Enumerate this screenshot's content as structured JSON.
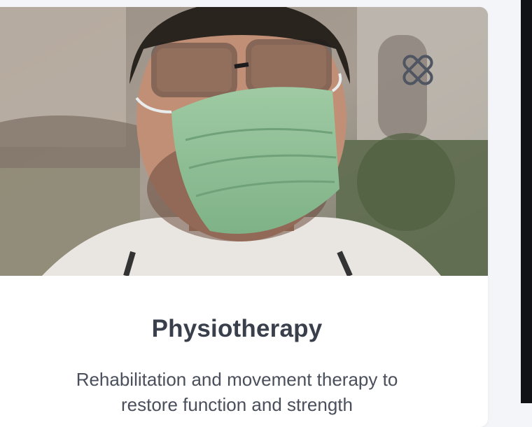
{
  "service": {
    "title": "Physiotherapy",
    "description": "Rehabilitation and movement therapy to restore function and strength",
    "image_alt": "Doctor wearing a surgical mask and glasses",
    "badge_icon": "bandage-icon"
  },
  "colors": {
    "title": "#3a3f4c",
    "description": "#4a4f5c",
    "page_bg": "#f4f5f8",
    "dark_panel": "#111216"
  }
}
